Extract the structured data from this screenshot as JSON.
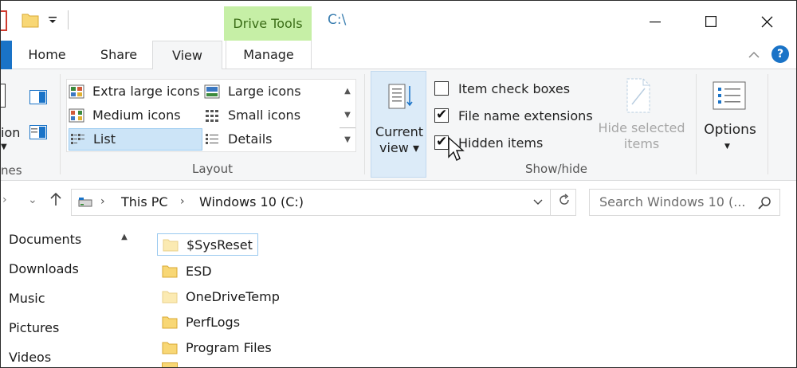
{
  "window": {
    "context_tab": "Drive Tools",
    "title": "C:\\"
  },
  "tabs": {
    "home": "Home",
    "share": "Share",
    "view": "View",
    "manage": "Manage"
  },
  "ribbon": {
    "panes": {
      "nav_cut_label": "ion",
      "group_cut_label": "nes"
    },
    "layout": {
      "group_label": "Layout",
      "items": [
        {
          "label": "Extra large icons"
        },
        {
          "label": "Large icons"
        },
        {
          "label": "Medium icons"
        },
        {
          "label": "Small icons"
        },
        {
          "label": "List"
        },
        {
          "label": "Details"
        }
      ]
    },
    "current_view": {
      "line1": "Current",
      "line2": "view ▾"
    },
    "show_hide": {
      "group_label": "Show/hide",
      "item_check_boxes": "Item check boxes",
      "file_name_extensions": "File name extensions",
      "hidden_items": "Hidden items",
      "hide_selected_line1": "Hide selected",
      "hide_selected_line2": "items"
    },
    "options_label": "Options"
  },
  "address": {
    "segments": [
      "This PC",
      "Windows 10 (C:)"
    ],
    "search_placeholder": "Search Windows 10 (..."
  },
  "nav_pane": {
    "items": [
      "Documents",
      "Downloads",
      "Music",
      "Pictures",
      "Videos"
    ]
  },
  "files": [
    {
      "name": "$SysReset",
      "hidden": true
    },
    {
      "name": "ESD",
      "hidden": false
    },
    {
      "name": "OneDriveTemp",
      "hidden": true
    },
    {
      "name": "PerfLogs",
      "hidden": false
    },
    {
      "name": "Program Files",
      "hidden": false
    }
  ],
  "colors": {
    "accent": "#1a73c7",
    "drive_tools_bg": "#c6efa6",
    "selection_bg": "#cce4f7",
    "folder": "#f8d775",
    "folder_hidden": "#fbeab2"
  }
}
